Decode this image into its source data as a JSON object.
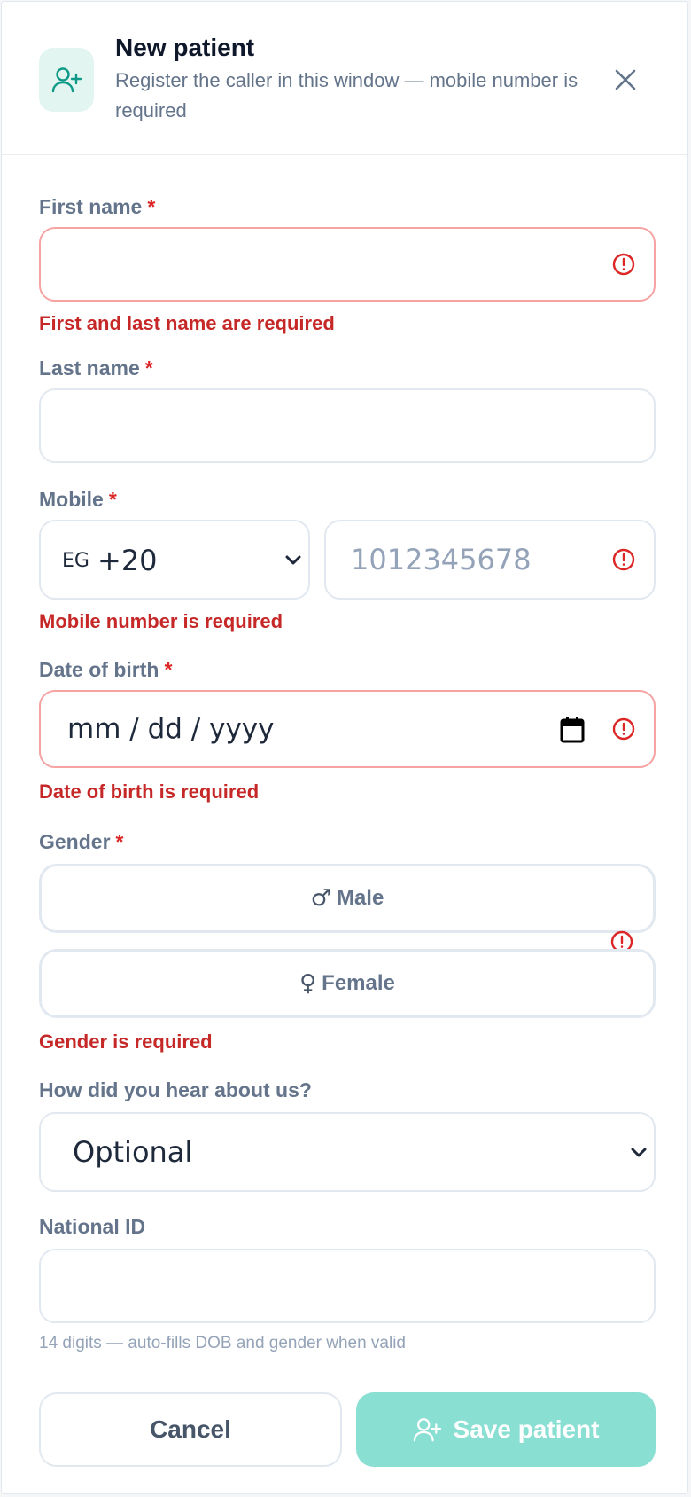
{
  "header": {
    "title": "New patient",
    "subtitle": "Register the caller in this window — mobile number is required",
    "icon": "user-plus-icon",
    "close_icon": "close-icon"
  },
  "form": {
    "required_marker": "*",
    "first_name": {
      "label": "First name",
      "value": "",
      "error": "First and last name are required"
    },
    "last_name": {
      "label": "Last name",
      "value": ""
    },
    "mobile": {
      "label": "Mobile",
      "country_code": "EG",
      "dial_code": "+20",
      "placeholder": "1012345678",
      "value": "",
      "error": "Mobile number is required"
    },
    "dob": {
      "label": "Date of birth",
      "placeholder_mm": "mm",
      "placeholder_dd": "dd",
      "placeholder_yyyy": "yyyy",
      "separator": "/",
      "error": "Date of birth is required",
      "icon": "calendar-icon"
    },
    "gender": {
      "label": "Gender",
      "options": [
        {
          "symbol": "♂",
          "label": "Male"
        },
        {
          "symbol": "♀",
          "label": "Female"
        }
      ],
      "error": "Gender is required"
    },
    "referral": {
      "label": "How did you hear about us?",
      "selected": "Optional"
    },
    "national_id": {
      "label": "National ID",
      "value": "",
      "hint": "14 digits — auto-fills DOB and gender when valid"
    }
  },
  "footer": {
    "cancel_label": "Cancel",
    "save_label": "Save patient"
  },
  "colors": {
    "accent": "#0f9a88",
    "accent_light": "#8adfd3",
    "error": "#dc2626",
    "error_border": "#f5a3a3"
  }
}
